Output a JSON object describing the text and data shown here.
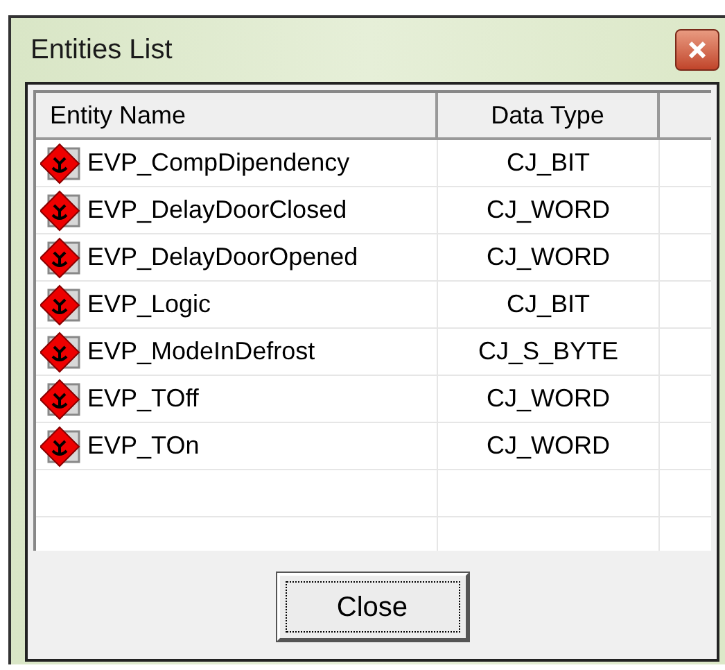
{
  "window": {
    "title": "Entities List"
  },
  "table": {
    "columns": [
      "Entity Name",
      "Data Type"
    ],
    "rows": [
      {
        "name": "EVP_CompDipendency",
        "type": "CJ_BIT"
      },
      {
        "name": "EVP_DelayDoorClosed",
        "type": "CJ_WORD"
      },
      {
        "name": "EVP_DelayDoorOpened",
        "type": "CJ_WORD"
      },
      {
        "name": "EVP_Logic",
        "type": "CJ_BIT"
      },
      {
        "name": "EVP_ModeInDefrost",
        "type": "CJ_S_BYTE"
      },
      {
        "name": "EVP_TOff",
        "type": "CJ_WORD"
      },
      {
        "name": "EVP_TOn",
        "type": "CJ_WORD"
      }
    ]
  },
  "buttons": [
    "Close"
  ]
}
